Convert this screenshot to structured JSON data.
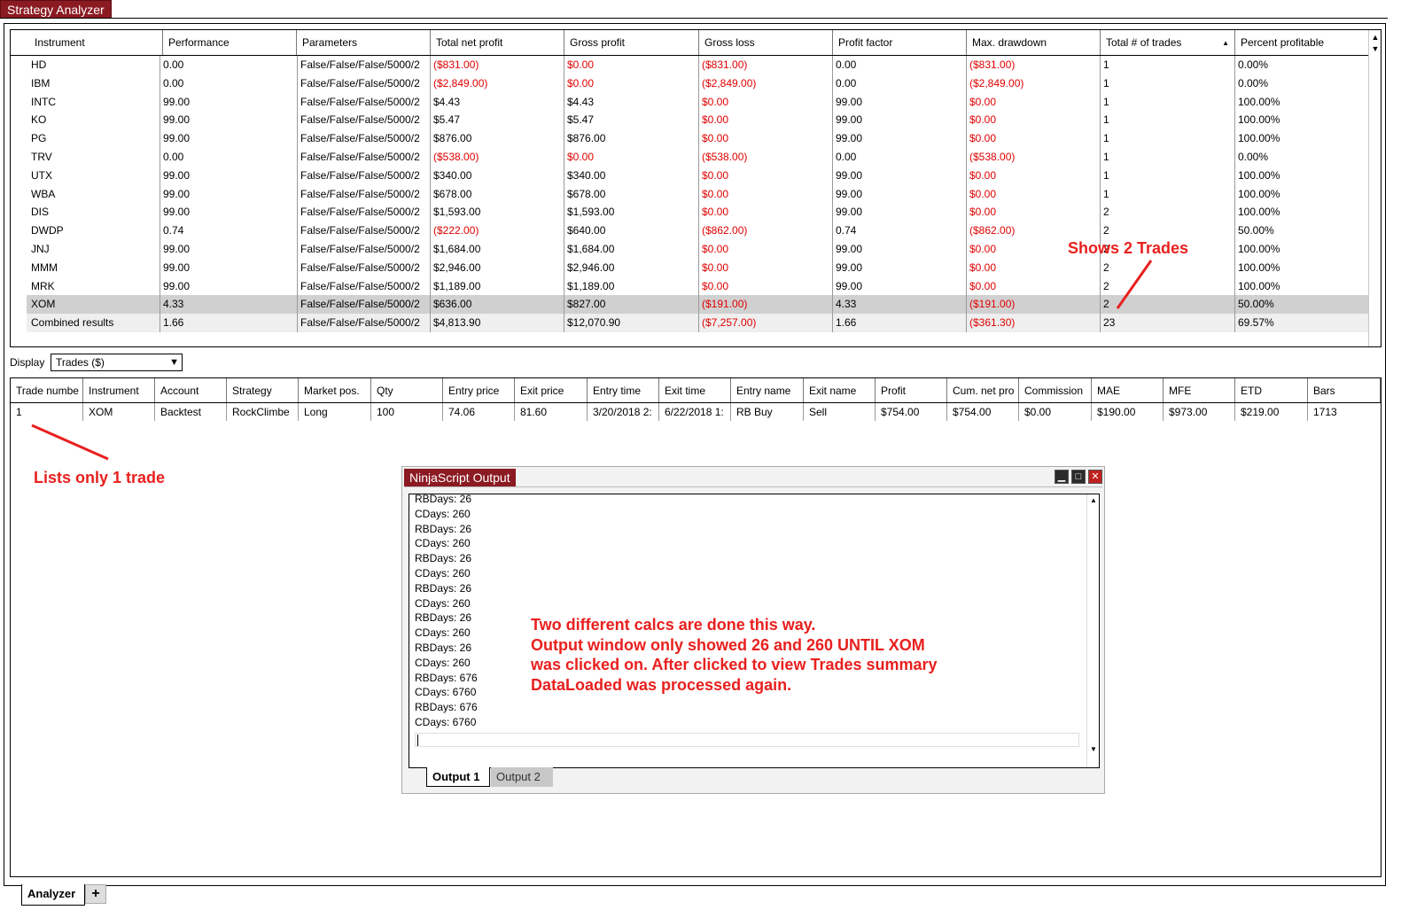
{
  "app": {
    "title_tab": "Strategy Analyzer",
    "bottom_tab": "Analyzer",
    "add_tab_symbol": "+"
  },
  "colors": {
    "accent": "#8b1a22",
    "negative": "#e00000",
    "annotation": "#e8201e",
    "selected_row": "#d0d0d0"
  },
  "results_grid": {
    "columns": [
      "Instrument",
      "Performance",
      "Parameters",
      "Total net profit",
      "Gross profit",
      "Gross loss",
      "Profit factor",
      "Max. drawdown",
      "Total # of trades",
      "Percent profitable"
    ],
    "sorted_column": "Total # of trades",
    "rows": [
      {
        "cells": [
          "HD",
          "0.00",
          "False/False/False/5000/2",
          "($831.00)",
          "$0.00",
          "($831.00)",
          "0.00",
          "($831.00)",
          "1",
          "0.00%"
        ]
      },
      {
        "cells": [
          "IBM",
          "0.00",
          "False/False/False/5000/2",
          "($2,849.00)",
          "$0.00",
          "($2,849.00)",
          "0.00",
          "($2,849.00)",
          "1",
          "0.00%"
        ]
      },
      {
        "cells": [
          "INTC",
          "99.00",
          "False/False/False/5000/2",
          "$4.43",
          "$4.43",
          "$0.00",
          "99.00",
          "$0.00",
          "1",
          "100.00%"
        ]
      },
      {
        "cells": [
          "KO",
          "99.00",
          "False/False/False/5000/2",
          "$5.47",
          "$5.47",
          "$0.00",
          "99.00",
          "$0.00",
          "1",
          "100.00%"
        ]
      },
      {
        "cells": [
          "PG",
          "99.00",
          "False/False/False/5000/2",
          "$876.00",
          "$876.00",
          "$0.00",
          "99.00",
          "$0.00",
          "1",
          "100.00%"
        ]
      },
      {
        "cells": [
          "TRV",
          "0.00",
          "False/False/False/5000/2",
          "($538.00)",
          "$0.00",
          "($538.00)",
          "0.00",
          "($538.00)",
          "1",
          "0.00%"
        ]
      },
      {
        "cells": [
          "UTX",
          "99.00",
          "False/False/False/5000/2",
          "$340.00",
          "$340.00",
          "$0.00",
          "99.00",
          "$0.00",
          "1",
          "100.00%"
        ]
      },
      {
        "cells": [
          "WBA",
          "99.00",
          "False/False/False/5000/2",
          "$678.00",
          "$678.00",
          "$0.00",
          "99.00",
          "$0.00",
          "1",
          "100.00%"
        ]
      },
      {
        "cells": [
          "DIS",
          "99.00",
          "False/False/False/5000/2",
          "$1,593.00",
          "$1,593.00",
          "$0.00",
          "99.00",
          "$0.00",
          "2",
          "100.00%"
        ]
      },
      {
        "cells": [
          "DWDP",
          "0.74",
          "False/False/False/5000/2",
          "($222.00)",
          "$640.00",
          "($862.00)",
          "0.74",
          "($862.00)",
          "2",
          "50.00%"
        ]
      },
      {
        "cells": [
          "JNJ",
          "99.00",
          "False/False/False/5000/2",
          "$1,684.00",
          "$1,684.00",
          "$0.00",
          "99.00",
          "$0.00",
          "2",
          "100.00%"
        ]
      },
      {
        "cells": [
          "MMM",
          "99.00",
          "False/False/False/5000/2",
          "$2,946.00",
          "$2,946.00",
          "$0.00",
          "99.00",
          "$0.00",
          "2",
          "100.00%"
        ]
      },
      {
        "cells": [
          "MRK",
          "99.00",
          "False/False/False/5000/2",
          "$1,189.00",
          "$1,189.00",
          "$0.00",
          "99.00",
          "$0.00",
          "2",
          "100.00%"
        ]
      },
      {
        "cells": [
          "XOM",
          "4.33",
          "False/False/False/5000/2",
          "$636.00",
          "$827.00",
          "($191.00)",
          "4.33",
          "($191.00)",
          "2",
          "50.00%"
        ],
        "selected": true
      },
      {
        "cells": [
          "Combined results",
          "1.66",
          "False/False/False/5000/2",
          "$4,813.90",
          "$12,070.90",
          "($7,257.00)",
          "1.66",
          "($361.30)",
          "23",
          "69.57%"
        ],
        "combined": true
      }
    ]
  },
  "display": {
    "label": "Display",
    "selected": "Trades ($)"
  },
  "trades_grid": {
    "columns": [
      "Trade numbe",
      "Instrument",
      "Account",
      "Strategy",
      "Market pos.",
      "Qty",
      "Entry price",
      "Exit price",
      "Entry time",
      "Exit time",
      "Entry name",
      "Exit name",
      "Profit",
      "Cum. net pro",
      "Commission",
      "MAE",
      "MFE",
      "ETD",
      "Bars"
    ],
    "rows": [
      {
        "cells": [
          "1",
          "XOM",
          "Backtest",
          "RockClimbe",
          "Long",
          "100",
          "74.06",
          "81.60",
          "3/20/2018 2:",
          "6/22/2018 1:",
          "RB Buy",
          "Sell",
          "$754.00",
          "$754.00",
          "$0.00",
          "$190.00",
          "$973.00",
          "$219.00",
          "1713"
        ]
      }
    ]
  },
  "annotations": {
    "shows_2_trades": "Shows 2 Trades",
    "lists_only_1": "Lists only 1 trade",
    "note_lines": [
      "Two different calcs are done this way.",
      "Output window only showed 26 and 260 UNTIL XOM",
      "was clicked on. After clicked to view Trades summary",
      "DataLoaded was processed again."
    ]
  },
  "output_window": {
    "title": "NinjaScript Output",
    "lines": [
      "RBDays: 26",
      "CDays: 260",
      "RBDays: 26",
      "CDays: 260",
      "RBDays: 26",
      "CDays: 260",
      "RBDays: 26",
      "CDays: 260",
      "RBDays: 26",
      "CDays: 260",
      "RBDays: 26",
      "CDays: 260",
      "RBDays: 676",
      "CDays: 6760",
      "RBDays: 676",
      "CDays: 6760"
    ],
    "tabs": [
      "Output 1",
      "Output 2"
    ]
  }
}
